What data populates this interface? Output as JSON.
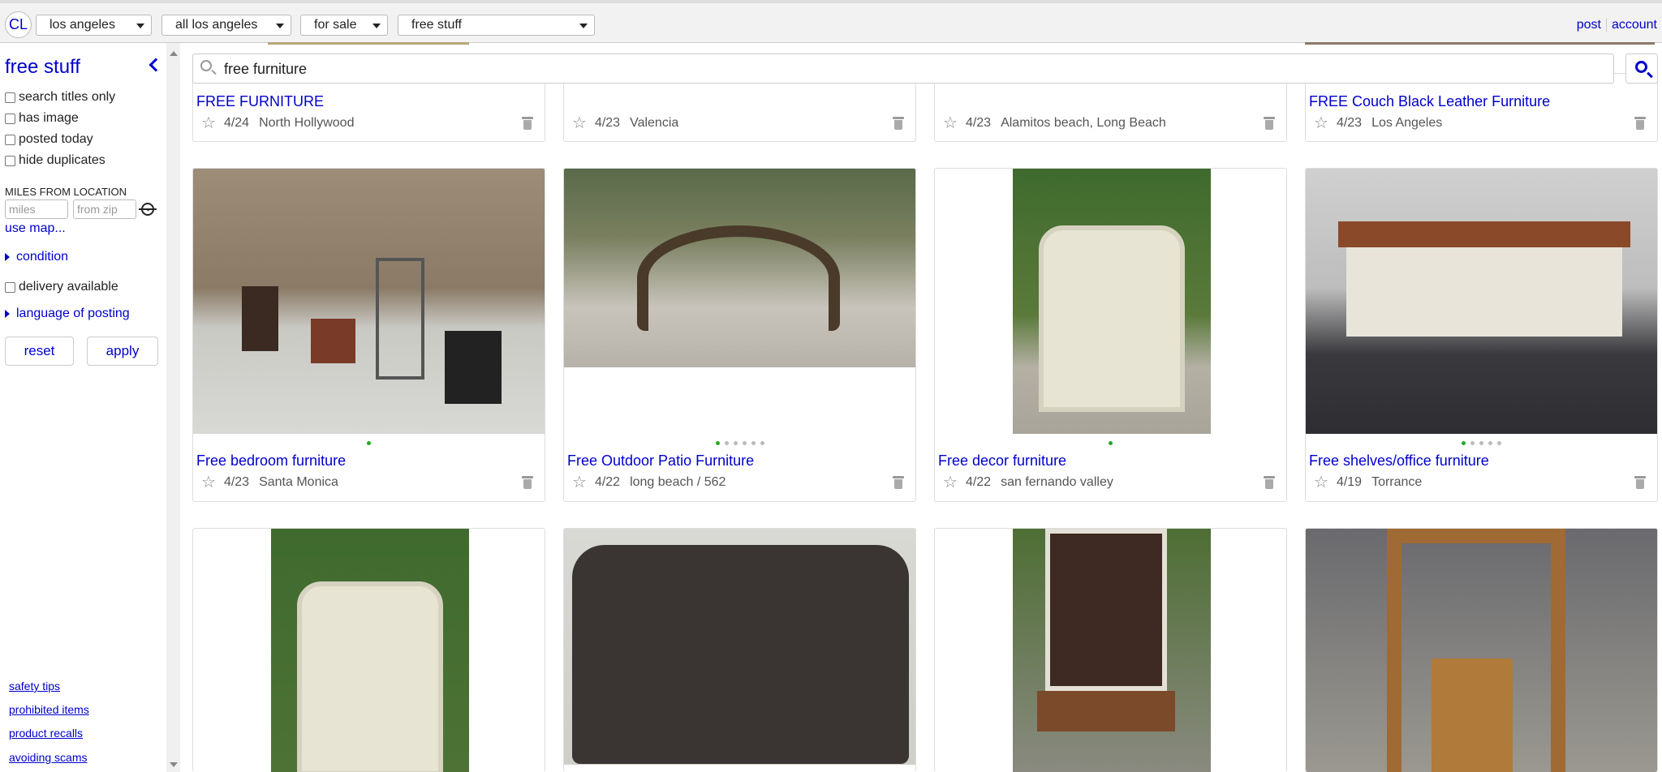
{
  "topbar": {
    "logo": "CL",
    "dropdowns": [
      {
        "label": "los angeles"
      },
      {
        "label": "all los angeles"
      },
      {
        "label": "for sale"
      },
      {
        "label": "free stuff"
      }
    ],
    "links": {
      "post": "post",
      "account": "account"
    }
  },
  "sidebar": {
    "title": "free stuff",
    "checkboxes": [
      {
        "label": "search titles only"
      },
      {
        "label": "has image"
      },
      {
        "label": "posted today"
      },
      {
        "label": "hide duplicates"
      }
    ],
    "miles_label": "MILES FROM LOCATION",
    "miles_placeholder": "miles",
    "zip_placeholder": "from zip",
    "use_map": "use map...",
    "condition": "condition",
    "delivery": "delivery available",
    "language": "language of posting",
    "reset": "reset",
    "apply": "apply",
    "footer_links": [
      "safety tips",
      "prohibited items",
      "product recalls",
      "avoiding scams"
    ]
  },
  "search": {
    "value": "free furniture"
  },
  "row1": [
    {
      "title": "FREE FURNITURE",
      "date": "4/24",
      "location": "North Hollywood"
    },
    {
      "title": "",
      "date": "4/23",
      "location": "Valencia"
    },
    {
      "title": "",
      "date": "4/23",
      "location": "Alamitos beach, Long Beach"
    },
    {
      "title": "FREE Couch Black Leather Furniture",
      "date": "4/23",
      "location": "Los Angeles"
    }
  ],
  "row2": [
    {
      "title": "Free bedroom furniture",
      "date": "4/23",
      "location": "Santa Monica",
      "dots": 1,
      "active": 0
    },
    {
      "title": "Free Outdoor Patio Furniture",
      "date": "4/22",
      "location": "long beach / 562",
      "dots": 6,
      "active": 0
    },
    {
      "title": "Free decor furniture",
      "date": "4/22",
      "location": "san fernando valley",
      "dots": 1,
      "active": 0
    },
    {
      "title": "Free shelves/office furniture",
      "date": "4/19",
      "location": "Torrance",
      "dots": 5,
      "active": 0
    }
  ],
  "colors": {
    "link": "#0000cc",
    "dot_active": "#22aa22"
  }
}
